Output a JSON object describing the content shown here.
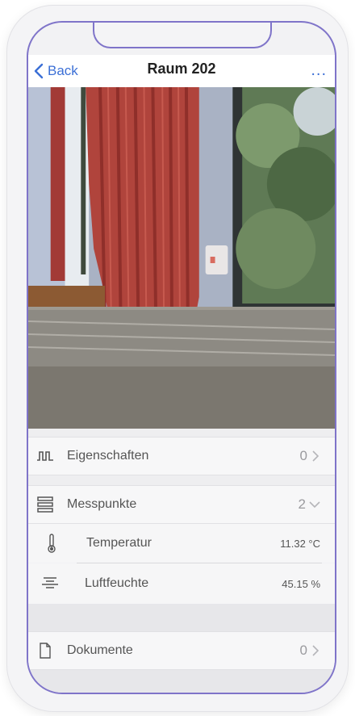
{
  "nav": {
    "back_label": "Back",
    "title": "Raum 202",
    "more_label": "..."
  },
  "photo": {
    "description_icon": "room-window-photo"
  },
  "list": {
    "eigenschaften": {
      "label": "Eigenschaften",
      "count": "0",
      "icon": "properties-icon"
    },
    "messpunkte": {
      "label": "Messpunkte",
      "count": "2",
      "icon": "stack-icon",
      "items": [
        {
          "label": "Temperatur",
          "value": "11.32 °C",
          "icon": "thermometer-icon"
        },
        {
          "label": "Luftfeuchte",
          "value": "45.15 %",
          "icon": "humidity-icon"
        }
      ]
    },
    "dokumente": {
      "label": "Dokumente",
      "count": "0",
      "icon": "document-icon"
    }
  },
  "colors": {
    "accent": "#3b6fd6",
    "frame": "#7f74c9"
  }
}
